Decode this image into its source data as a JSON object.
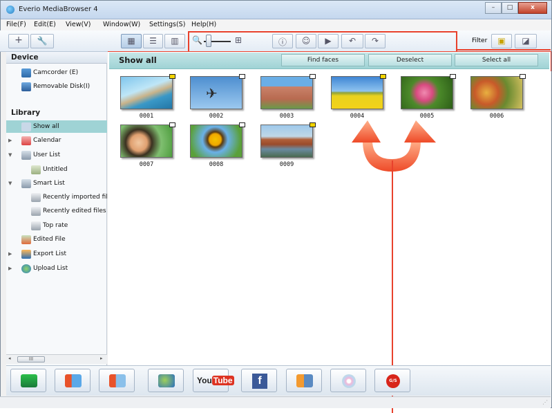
{
  "window": {
    "title": "Everio MediaBrowser 4",
    "controls": {
      "minimize": "–",
      "maximize": "□",
      "close": "x"
    }
  },
  "menu": [
    "File(F)",
    "Edit(E)",
    "View(V)",
    "Window(W)",
    "Settings(S)",
    "Help(H)"
  ],
  "toolbar": {
    "add_glyph": "+",
    "filter_label": "Filter"
  },
  "sidebar": {
    "device_header": "Device",
    "devices": [
      "Camcorder (E)",
      "Removable Disk(I)"
    ],
    "library_header": "Library",
    "items": [
      {
        "label": "Show all",
        "icon": "show-all-icon"
      },
      {
        "label": "Calendar",
        "icon": "calendar-icon"
      },
      {
        "label": "User List",
        "icon": "user-list-icon"
      },
      {
        "label": "Untitled",
        "icon": "album-icon"
      },
      {
        "label": "Smart List",
        "icon": "smart-list-icon"
      },
      {
        "label": "Recently imported files",
        "icon": "smart-album-icon"
      },
      {
        "label": "Recently edited files",
        "icon": "smart-album-icon"
      },
      {
        "label": "Top rate",
        "icon": "smart-album-icon"
      },
      {
        "label": "Edited File",
        "icon": "scissors-icon"
      },
      {
        "label": "Export List",
        "icon": "export-icon"
      },
      {
        "label": "Upload List",
        "icon": "upload-icon"
      }
    ],
    "scroll_thumb": "III"
  },
  "main": {
    "view_title": "Show all",
    "buttons": {
      "find_faces": "Find faces",
      "deselect": "Deselect",
      "select_all": "Select all"
    },
    "thumbnails": [
      "0001",
      "0002",
      "0003",
      "0004",
      "0005",
      "0006",
      "0007",
      "0008",
      "0009"
    ]
  },
  "bottom_toolbar": {
    "youtube_label": "You",
    "youtube_tube": "Tube",
    "facebook_label": "f",
    "gs_label": "G/S"
  },
  "colors": {
    "banner": "#9fd3d5",
    "selection": "#9fd3d5",
    "annotation": "#e8412c"
  }
}
